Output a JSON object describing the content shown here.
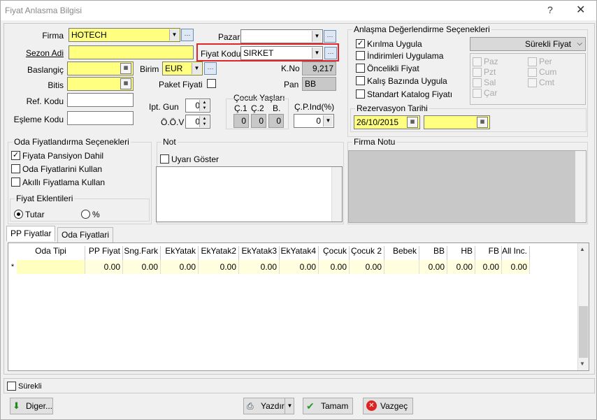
{
  "window": {
    "title": "Fiyat Anlasma Bilgisi",
    "help": "?",
    "close": "✕"
  },
  "form": {
    "firma_label": "Firma",
    "firma_value": "HOTECH",
    "sezon_label": "Sezon Adi",
    "sezon_value": "",
    "baslangic_label": "Baslangiç",
    "bitis_label": "Bitis",
    "refkodu_label": "Ref. Kodu",
    "eslemekodu_label": "Eşleme Kodu",
    "birim_label": "Birim",
    "birim_value": "EUR",
    "paket_label": "Paket Fiyati",
    "iptgun_label": "Ipt. Gun",
    "iptgun_value": "0",
    "oov_label": "Ö.Ö.V",
    "oov_value": "0",
    "pazar_label": "Pazar",
    "pazar_value": "",
    "fiyatkodu_label": "Fiyat Kodu",
    "fiyatkodu_value": "SIRKET",
    "kno_label": "K.No",
    "kno_value": "9,217",
    "pan_label": "Pan",
    "pan_value": "BB",
    "cocuk_title": "Çocuk Yaşları",
    "c1": "Ç.1",
    "c2": "Ç.2",
    "b": "B.",
    "c1_val": "0",
    "c2_val": "0",
    "b_val": "0",
    "cpind_label": "Ç.P.Ind(%)",
    "cpind_value": "0"
  },
  "evaluation": {
    "title": "Anlaşma Değerlendirme Seçenekleri",
    "kirilma": "Kırılma Uygula",
    "indirim": "İndirimleri Uygulama",
    "oncelikli": "Öncelikli Fiyat",
    "kalis": "Kalış Bazında Uygula",
    "standart": "Standart Katalog Fiyatı",
    "mode": "Sürekli Fiyat",
    "days": [
      "Paz",
      "Per",
      "Pzt",
      "Cum",
      "Sal",
      "Cmt",
      "Çar"
    ],
    "rez_title": "Rezervasyon Tarihi",
    "rez_date": "26/10/2015"
  },
  "oda": {
    "title": "Oda Fiyatlandırma Seçenekleri",
    "pansiyon": "Fiyata Pansiyon Dahil",
    "kullan": "Oda Fiyatlarini Kullan",
    "akilli": "Akıllı Fiyatlama Kullan",
    "eklenti_title": "Fiyat Eklentileri",
    "tutar": "Tutar",
    "yuzde": "%"
  },
  "not": {
    "title": "Not",
    "uyari": "Uyarı Göster"
  },
  "firmanotu": {
    "title": "Firma Notu"
  },
  "tabs": [
    "PP Fiyatlar",
    "Oda Fiyatlari"
  ],
  "grid": {
    "columns": [
      "Oda Tipi",
      "PP Fiyat",
      "Sng.Fark",
      "EkYatak",
      "EkYatak2",
      "EkYatak3",
      "EkYatak4",
      "Çocuk",
      "Çocuk 2",
      "Bebek",
      "BB",
      "HB",
      "FB",
      "All Inc."
    ],
    "row": [
      "",
      "0.00",
      "0.00",
      "0.00",
      "0.00",
      "0.00",
      "0.00",
      "0.00",
      "0.00",
      "",
      "0.00",
      "0.00",
      "0.00",
      "0.00"
    ],
    "marker": "*"
  },
  "footer": {
    "surekli": "Sürekli",
    "diger": "Diger...",
    "yazdir": "Yazdır",
    "tamam": "Tamam",
    "vazgec": "Vazgeç"
  }
}
